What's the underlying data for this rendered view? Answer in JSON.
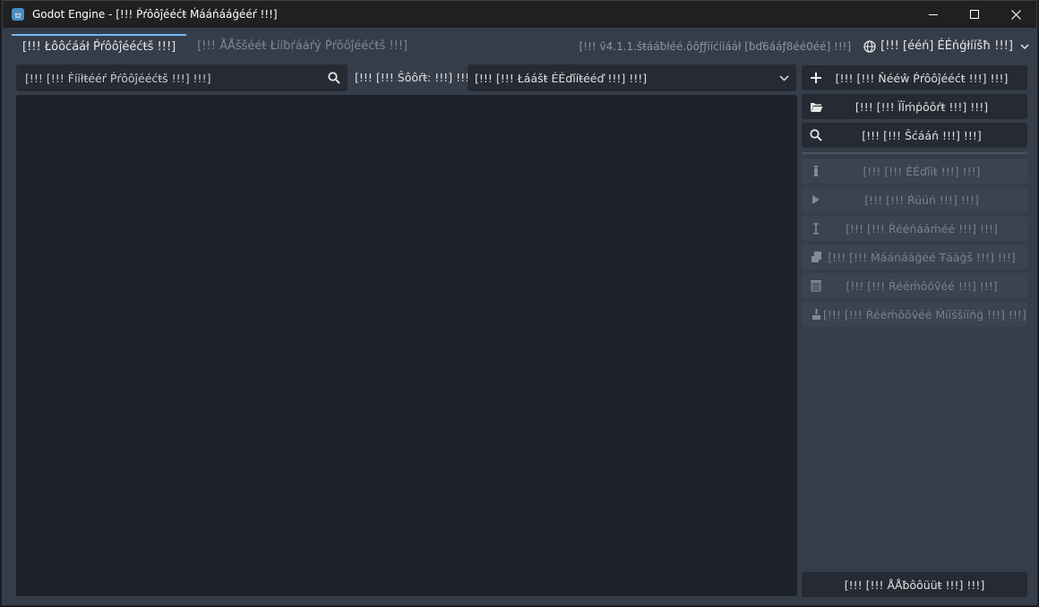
{
  "window": {
    "title": "Godot Engine - [!!! Ṕŕôôĵééćŧ Ḿááńááǵééŕ !!!]",
    "icon": "godot-logo-icon",
    "controls": {
      "minimize": "—",
      "maximize": "☐",
      "close": "✕"
    }
  },
  "tabs": [
    {
      "label": "[!!! Łôôćááł Ṕŕôôĵééćŧš !!!]",
      "active": true
    },
    {
      "label": "[!!! ÅÅššééŧ Łííƀŕááŕý Ṕŕôôĵééćŧš !!!]",
      "active": false
    }
  ],
  "version": "[!!! ṽ4.1.1.šŧááƀłéé.ôôƒƒííćííááł [ƀď6ááƒ8éé0éé] !!!]",
  "language": {
    "label": "[!!! [ééń] ÉÉńǵłííšħ !!!]"
  },
  "filter": {
    "placeholder": "[!!! [!!! Ḟííłŧééŕ Ṕŕôôĵééćŧš !!!] !!!]"
  },
  "sort": {
    "label": "[!!! [!!! Ŝôôŕŧ: !!!] !!!]",
    "selected": "[!!! [!!! Łáášŧ ÉÉďííŧééď !!!] !!!]"
  },
  "actions": {
    "new_project": "[!!! [!!! Ňééŵ Ṕŕôôĵééćŧ !!!] !!!]",
    "import": "[!!! [!!! ÏÏḿṕôôŕŧ !!!] !!!]",
    "scan": "[!!! [!!! Ŝćááń !!!] !!!]",
    "edit": "[!!! [!!! ÉÉďííŧ !!!] !!!]",
    "run": "[!!! [!!! Ŕüüń !!!] !!!]",
    "rename": "[!!! [!!! Ŕééńááḿéé !!!] !!!]",
    "manage_tags": "[!!! [!!! Ḿááńááǵéé Ŧááǵš !!!] !!!]",
    "remove": "[!!! [!!! Ŕééḿôôṽéé !!!] !!!]",
    "remove_missing": "[!!! [!!! Ŕééḿôôṽéé Ḿííššííńǵ !!!] !!!]",
    "about": "[!!! [!!! ÅÅƀôôüüŧ !!!] !!!]"
  },
  "colors": {
    "accent": "#70bafa",
    "panel": "#363d4a",
    "list_bg": "#1e222a",
    "field_bg": "#252a33"
  }
}
